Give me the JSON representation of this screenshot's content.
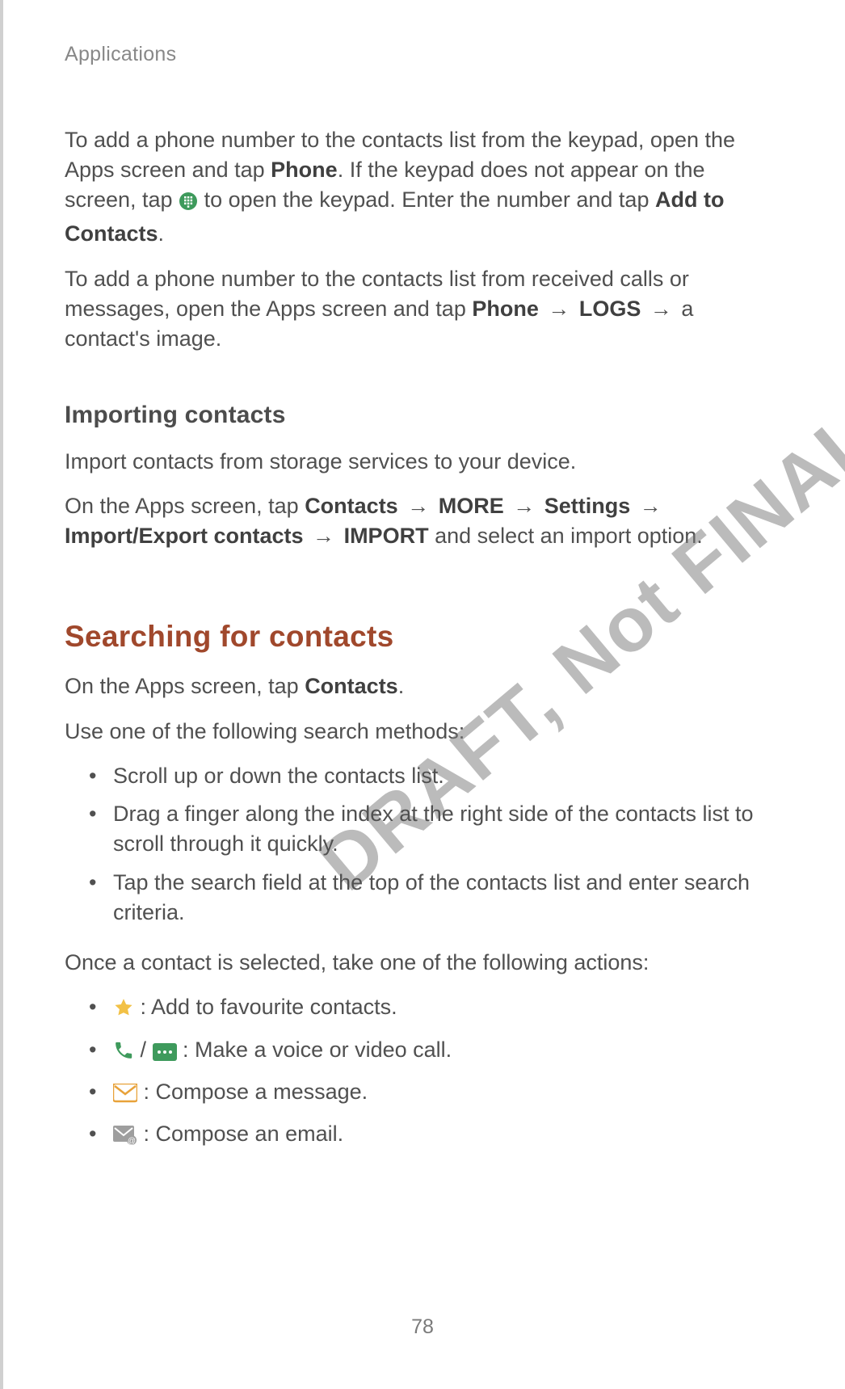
{
  "header": "Applications",
  "watermark": "DRAFT, Not FINAL",
  "page_number": "78",
  "p1": {
    "t1": "To add a phone number to the contacts list from the keypad, open the Apps screen and tap ",
    "b1": "Phone",
    "t2": ". If the keypad does not appear on the screen, tap ",
    "icon": "keypad-icon",
    "t3": " to open the keypad. Enter the number and tap ",
    "b2": "Add to Contacts",
    "t4": "."
  },
  "p2": {
    "t1": "To add a phone number to the contacts list from received calls or messages, open the Apps screen and tap ",
    "b1": "Phone",
    "arrow1": " → ",
    "b2": "LOGS",
    "arrow2": " → ",
    "t2": "a contact's image."
  },
  "importing_heading": "Importing contacts",
  "p3": "Import contacts from storage services to your device.",
  "p4": {
    "t1": "On the Apps screen, tap ",
    "b1": "Contacts",
    "arrow1": " → ",
    "b2": "MORE",
    "arrow2": " → ",
    "b3": "Settings",
    "arrow3": " → ",
    "b4": "Import/Export contacts",
    "arrow4": " → ",
    "b5": "IMPORT",
    "t2": " and select an import option."
  },
  "searching_heading": "Searching for contacts",
  "p5": {
    "t1": "On the Apps screen, tap ",
    "b1": "Contacts",
    "t2": "."
  },
  "p6": "Use one of the following search methods:",
  "methods": [
    "Scroll up or down the contacts list.",
    "Drag a finger along the index at the right side of the contacts list to scroll through it quickly.",
    "Tap the search field at the top of the contacts list and enter search criteria."
  ],
  "p7": "Once a contact is selected, take one of the following actions:",
  "actions": {
    "fav": " : Add to favourite contacts.",
    "call_sep": " / ",
    "call": " : Make a voice or video call.",
    "msg": " : Compose a message.",
    "email": " : Compose an email."
  },
  "icons": {
    "keypad": "dialpad-icon",
    "star": "star-icon",
    "phone": "phone-icon",
    "video": "video-icon",
    "message": "message-icon",
    "email": "email-icon"
  }
}
